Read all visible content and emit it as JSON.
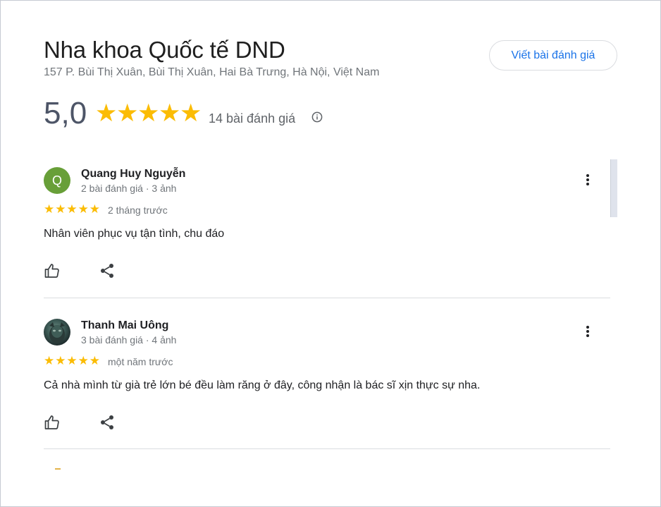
{
  "place": {
    "name": "Nha khoa Quốc tế DND",
    "address": "157 P. Bùi Thị Xuân, Bùi Thị Xuân, Hai Bà Trưng, Hà Nội, Việt Nam",
    "write_review_label": "Viết bài đánh giá",
    "rating": "5,0",
    "rating_stars": 5,
    "review_count": "14 bài đánh giá"
  },
  "colors": {
    "accent": "#1a73e8",
    "star": "#fbbc04",
    "avatar_green": "#689f38"
  },
  "reviews": [
    {
      "name": "Quang Huy Nguyễn",
      "initial": "Q",
      "avatar": "letter",
      "meta": "2 bài đánh giá · 3 ảnh",
      "stars": 5,
      "time": "2 tháng trước",
      "text": "Nhân viên phục vụ tận tình, chu đáo"
    },
    {
      "name": "Thanh Mai Uông",
      "avatar": "photo",
      "meta": "3 bài đánh giá · 4 ảnh",
      "stars": 5,
      "time": "một năm trước",
      "text": "Cả nhà mình từ già trẻ lớn bé đều làm răng ở đây, công nhận là bác sĩ xịn thực sự nha."
    }
  ],
  "icons": {
    "info": "info-icon",
    "more": "more-vert-icon",
    "like": "thumb-up-icon",
    "share": "share-icon"
  }
}
